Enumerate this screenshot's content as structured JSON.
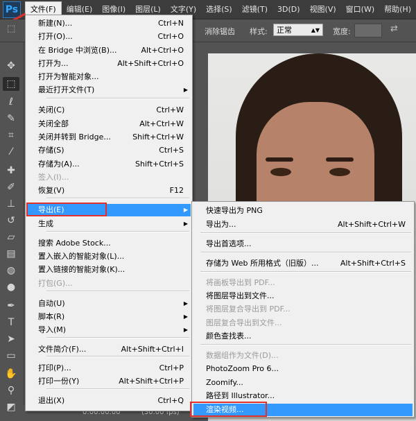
{
  "app": {
    "logo": "Ps"
  },
  "menubar": [
    {
      "label": "文件(F)",
      "active": true
    },
    {
      "label": "编辑(E)"
    },
    {
      "label": "图像(I)"
    },
    {
      "label": "图层(L)"
    },
    {
      "label": "文字(Y)"
    },
    {
      "label": "选择(S)"
    },
    {
      "label": "滤镜(T)"
    },
    {
      "label": "3D(D)"
    },
    {
      "label": "视图(V)"
    },
    {
      "label": "窗口(W)"
    },
    {
      "label": "帮助(H)"
    }
  ],
  "options": {
    "antialias": "消除锯齿",
    "style_label": "样式:",
    "style_value": "正常",
    "width_label": "宽度:"
  },
  "file_menu": [
    {
      "label": "新建(N)...",
      "shortcut": "Ctrl+N"
    },
    {
      "label": "打开(O)...",
      "shortcut": "Ctrl+O"
    },
    {
      "label": "在 Bridge 中浏览(B)...",
      "shortcut": "Alt+Ctrl+O"
    },
    {
      "label": "打开为...",
      "shortcut": "Alt+Shift+Ctrl+O"
    },
    {
      "label": "打开为智能对象...",
      "shortcut": ""
    },
    {
      "label": "最近打开文件(T)",
      "shortcut": "",
      "submenu": true
    },
    {
      "label": "关闭(C)",
      "shortcut": "Ctrl+W"
    },
    {
      "label": "关闭全部",
      "shortcut": "Alt+Ctrl+W"
    },
    {
      "label": "关闭并转到 Bridge...",
      "shortcut": "Shift+Ctrl+W"
    },
    {
      "label": "存储(S)",
      "shortcut": "Ctrl+S"
    },
    {
      "label": "存储为(A)...",
      "shortcut": "Shift+Ctrl+S"
    },
    {
      "label": "签入(I)...",
      "shortcut": "",
      "disabled": true
    },
    {
      "label": "恢复(V)",
      "shortcut": "F12"
    },
    {
      "label": "导出(E)",
      "shortcut": "",
      "submenu": true,
      "highlight": true
    },
    {
      "label": "生成",
      "shortcut": "",
      "submenu": true
    },
    {
      "label": "搜索 Adobe Stock...",
      "shortcut": ""
    },
    {
      "label": "置入嵌入的智能对象(L)...",
      "shortcut": ""
    },
    {
      "label": "置入链接的智能对象(K)...",
      "shortcut": ""
    },
    {
      "label": "打包(G)...",
      "shortcut": "",
      "disabled": true
    },
    {
      "label": "自动(U)",
      "shortcut": "",
      "submenu": true
    },
    {
      "label": "脚本(R)",
      "shortcut": "",
      "submenu": true
    },
    {
      "label": "导入(M)",
      "shortcut": "",
      "submenu": true
    },
    {
      "label": "文件简介(F)...",
      "shortcut": "Alt+Shift+Ctrl+I"
    },
    {
      "label": "打印(P)...",
      "shortcut": "Ctrl+P"
    },
    {
      "label": "打印一份(Y)",
      "shortcut": "Alt+Shift+Ctrl+P"
    },
    {
      "label": "退出(X)",
      "shortcut": "Ctrl+Q"
    }
  ],
  "export_submenu": [
    {
      "label": "快速导出为 PNG",
      "shortcut": ""
    },
    {
      "label": "导出为...",
      "shortcut": "Alt+Shift+Ctrl+W"
    },
    {
      "label": "导出首选项...",
      "shortcut": ""
    },
    {
      "label": "存储为 Web 所用格式（旧版）...",
      "shortcut": "Alt+Shift+Ctrl+S"
    },
    {
      "label": "将画板导出到 PDF...",
      "shortcut": "",
      "disabled": true
    },
    {
      "label": "将图层导出到文件...",
      "shortcut": ""
    },
    {
      "label": "将图层复合导出到 PDF...",
      "shortcut": "",
      "disabled": true
    },
    {
      "label": "图层复合导出到文件...",
      "shortcut": "",
      "disabled": true
    },
    {
      "label": "颜色查找表...",
      "shortcut": ""
    },
    {
      "label": "数据组作为文件(D)...",
      "shortcut": "",
      "disabled": true
    },
    {
      "label": "PhotoZoom Pro 6...",
      "shortcut": ""
    },
    {
      "label": "Zoomify...",
      "shortcut": ""
    },
    {
      "label": "路径到 Illustrator...",
      "shortcut": ""
    },
    {
      "label": "渲染视频...",
      "shortcut": "",
      "highlight": true
    }
  ],
  "status": {
    "timecode": "0:00:00:00",
    "fps": "(30.00 fps)"
  },
  "colors": {
    "highlight": "#3399ff",
    "annotation": "#e0302d"
  }
}
